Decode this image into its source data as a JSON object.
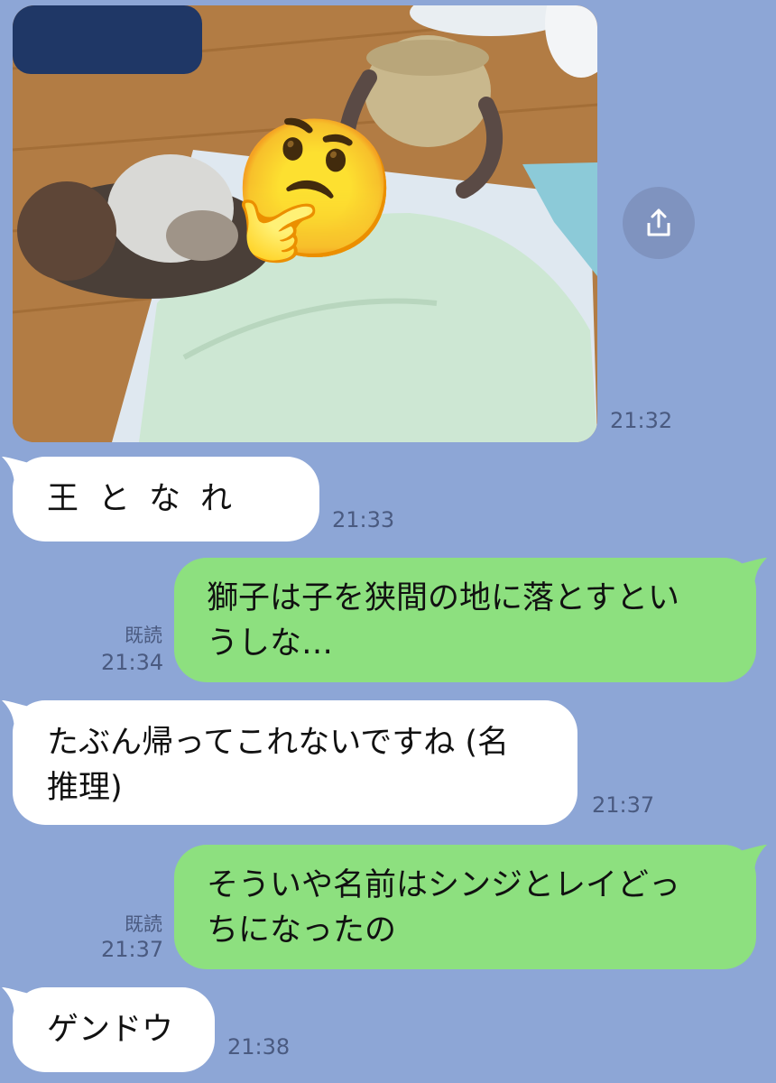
{
  "messages": [
    {
      "type": "image",
      "direction": "incoming",
      "image_desc": "photo with emoji",
      "emoji": "🤔",
      "time": "21:32"
    },
    {
      "type": "text",
      "direction": "incoming",
      "text": "王となれ",
      "time": "21:33"
    },
    {
      "type": "text",
      "direction": "outgoing",
      "text_line1": "獅子は子を狭間の地に落とすとい",
      "text_line2": "うしな…",
      "read": "既読",
      "time": "21:34"
    },
    {
      "type": "text",
      "direction": "incoming",
      "text_line1": "たぶん帰ってこれないですね (名",
      "text_line2": "推理)",
      "time": "21:37"
    },
    {
      "type": "text",
      "direction": "outgoing",
      "text_line1": "そういや名前はシンジとレイどっ",
      "text_line2": "ちになったの",
      "read": "既読",
      "time": "21:37"
    },
    {
      "type": "text",
      "direction": "incoming",
      "text": "ゲンドウ",
      "time": "21:38"
    }
  ],
  "colors": {
    "background": "#8da6d6",
    "incoming_bubble": "#ffffff",
    "outgoing_bubble": "#8de07f",
    "meta_text": "#4a5a80"
  },
  "icons": {
    "share": "share-icon"
  }
}
